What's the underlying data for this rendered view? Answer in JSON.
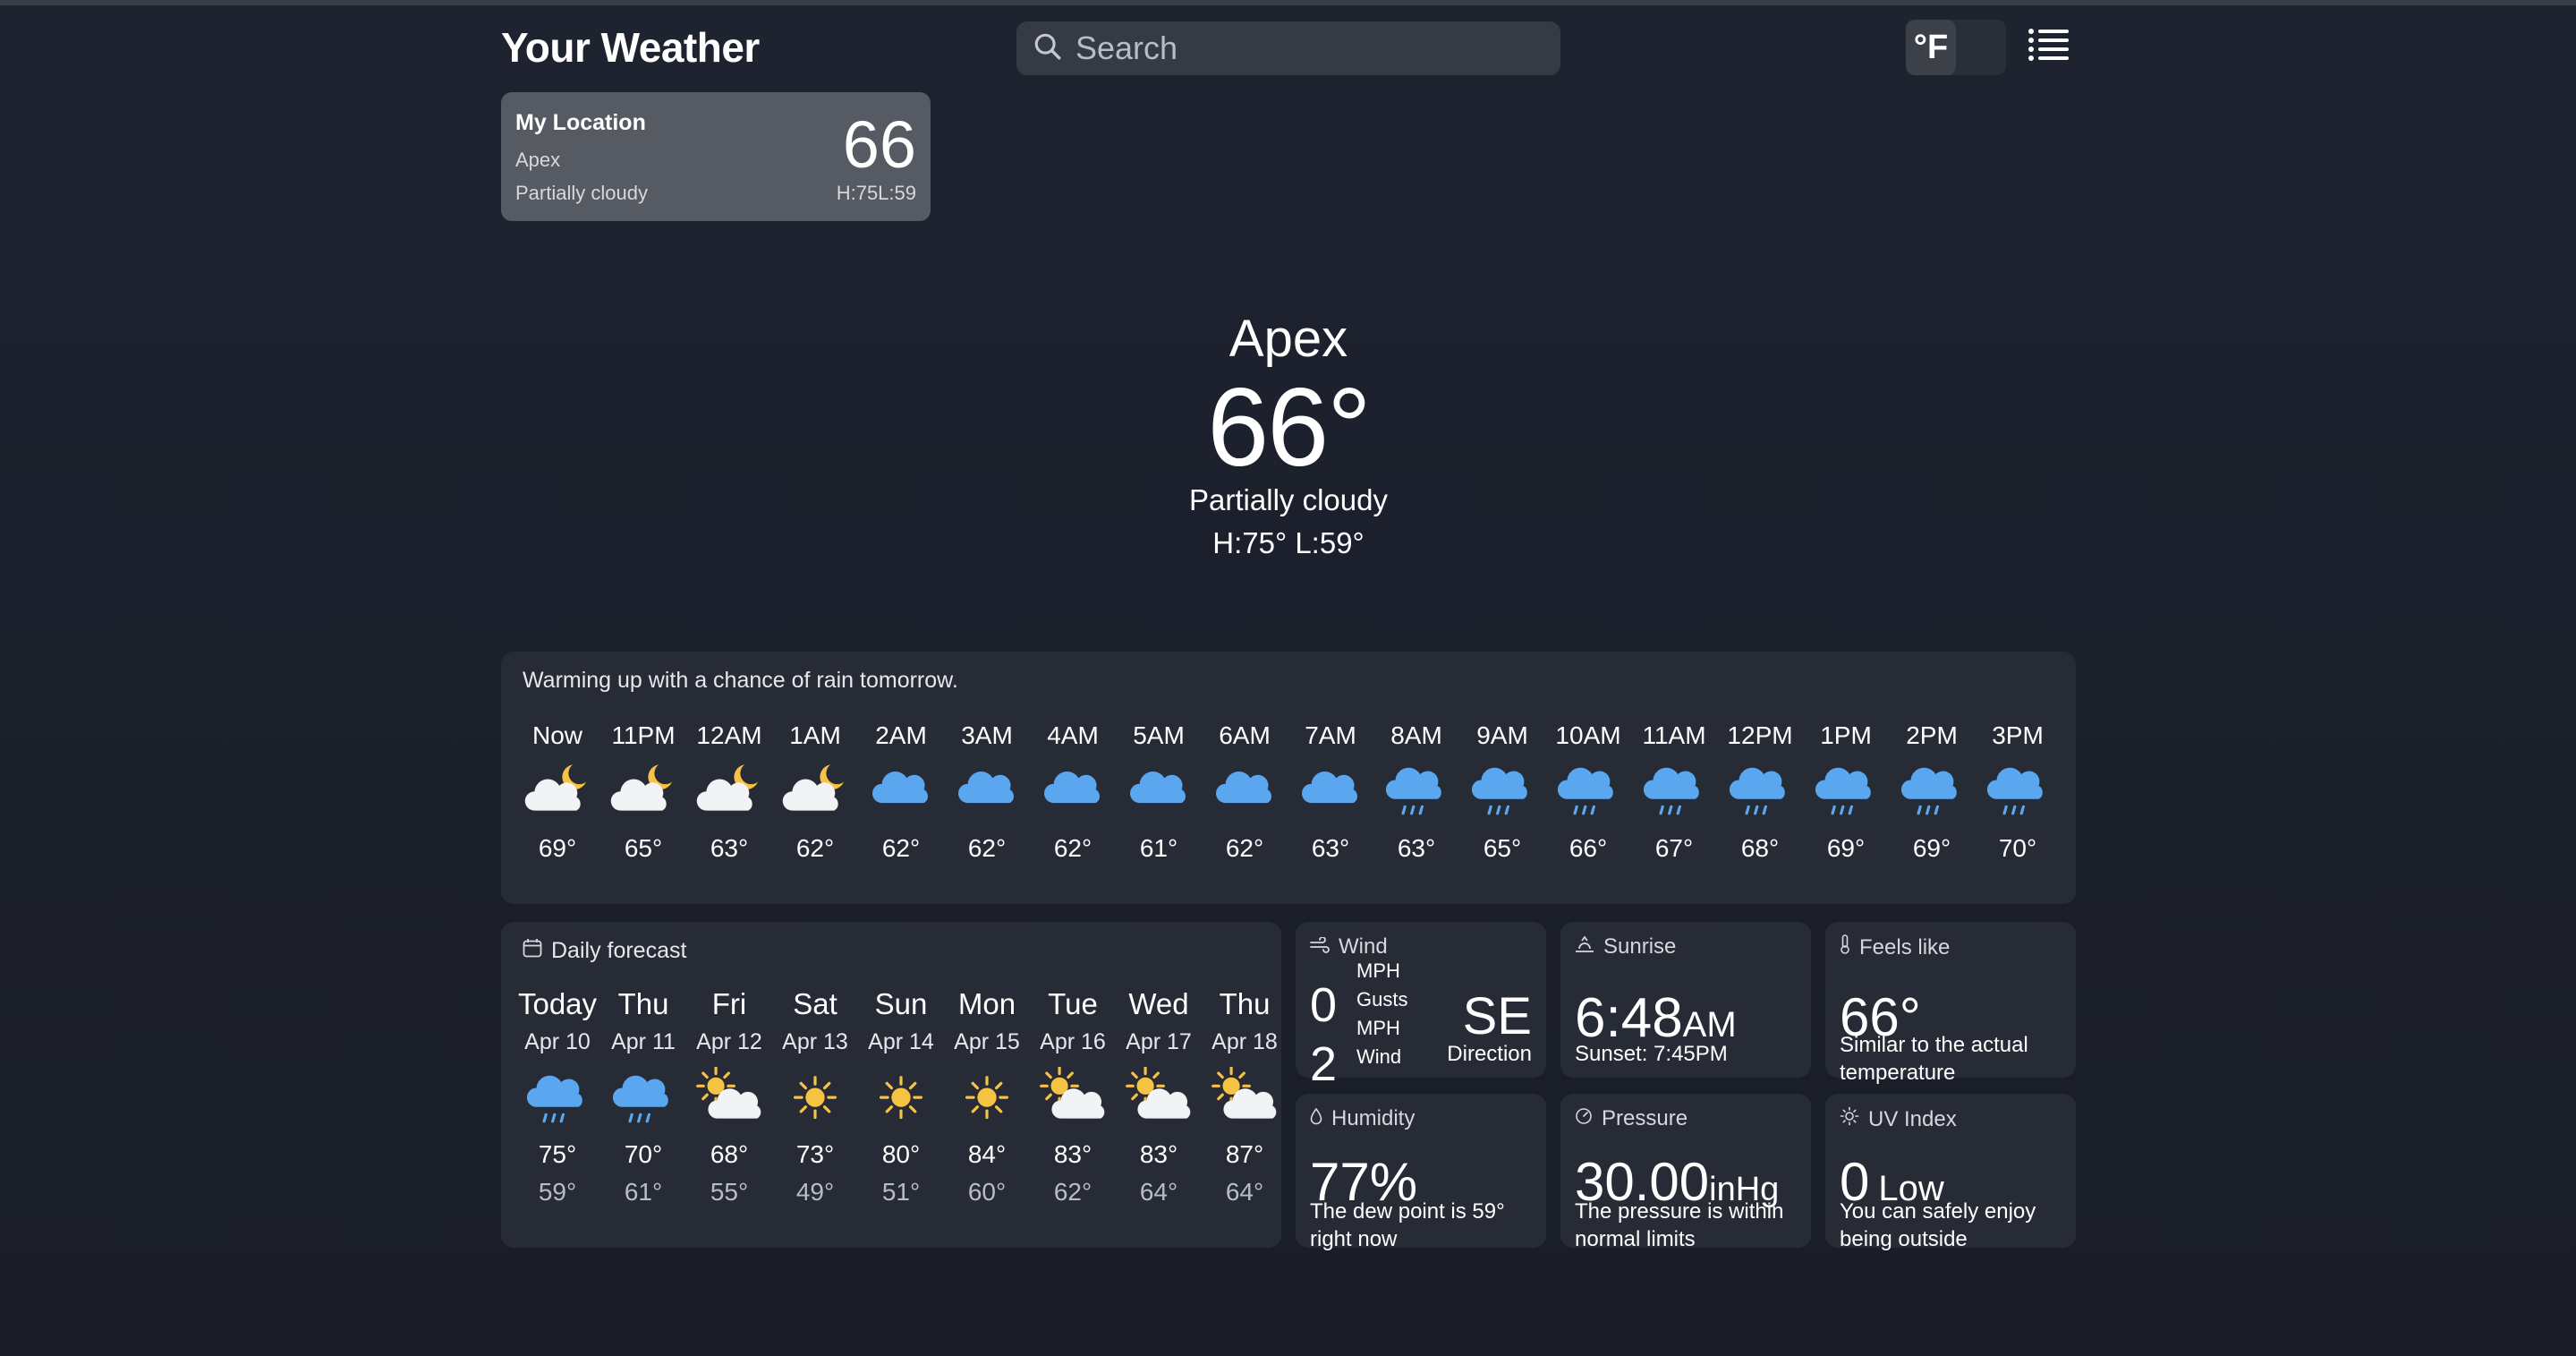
{
  "app": {
    "title": "Your Weather"
  },
  "search": {
    "placeholder": "Search"
  },
  "units": {
    "active": "°F",
    "inactive": ""
  },
  "location_card": {
    "name": "My Location",
    "place": "Apex",
    "condition": "Partially cloudy",
    "temp": "66",
    "high_low": "H:75L:59"
  },
  "current": {
    "city": "Apex",
    "temp": "66°",
    "condition": "Partially cloudy",
    "high_low": "H:75°  L:59°"
  },
  "hourly": {
    "summary": "Warming up with a chance of rain tomorrow.",
    "items": [
      {
        "time": "Now",
        "icon": "cloud-moon-icon",
        "temp": "69°"
      },
      {
        "time": "11PM",
        "icon": "cloud-moon-icon",
        "temp": "65°"
      },
      {
        "time": "12AM",
        "icon": "cloud-moon-icon",
        "temp": "63°"
      },
      {
        "time": "1AM",
        "icon": "cloud-moon-icon",
        "temp": "62°"
      },
      {
        "time": "2AM",
        "icon": "cloud-icon",
        "temp": "62°"
      },
      {
        "time": "3AM",
        "icon": "cloud-icon",
        "temp": "62°"
      },
      {
        "time": "4AM",
        "icon": "cloud-icon",
        "temp": "62°"
      },
      {
        "time": "5AM",
        "icon": "cloud-icon",
        "temp": "61°"
      },
      {
        "time": "6AM",
        "icon": "cloud-icon",
        "temp": "62°"
      },
      {
        "time": "7AM",
        "icon": "cloud-icon",
        "temp": "63°"
      },
      {
        "time": "8AM",
        "icon": "cloud-rain-icon",
        "temp": "63°"
      },
      {
        "time": "9AM",
        "icon": "cloud-rain-icon",
        "temp": "65°"
      },
      {
        "time": "10AM",
        "icon": "cloud-rain-icon",
        "temp": "66°"
      },
      {
        "time": "11AM",
        "icon": "cloud-rain-icon",
        "temp": "67°"
      },
      {
        "time": "12PM",
        "icon": "cloud-rain-icon",
        "temp": "68°"
      },
      {
        "time": "1PM",
        "icon": "cloud-rain-icon",
        "temp": "69°"
      },
      {
        "time": "2PM",
        "icon": "cloud-rain-icon",
        "temp": "69°"
      },
      {
        "time": "3PM",
        "icon": "cloud-rain-icon",
        "temp": "70°"
      }
    ]
  },
  "daily": {
    "title": "Daily forecast",
    "items": [
      {
        "day": "Today",
        "date": "Apr 10",
        "icon": "cloud-rain-icon",
        "high": "75°",
        "low": "59°"
      },
      {
        "day": "Thu",
        "date": "Apr 11",
        "icon": "cloud-rain-icon",
        "high": "70°",
        "low": "61°"
      },
      {
        "day": "Fri",
        "date": "Apr 12",
        "icon": "cloud-sun-icon",
        "high": "68°",
        "low": "55°"
      },
      {
        "day": "Sat",
        "date": "Apr 13",
        "icon": "sun-icon",
        "high": "73°",
        "low": "49°"
      },
      {
        "day": "Sun",
        "date": "Apr 14",
        "icon": "sun-icon",
        "high": "80°",
        "low": "51°"
      },
      {
        "day": "Mon",
        "date": "Apr 15",
        "icon": "sun-icon",
        "high": "84°",
        "low": "60°"
      },
      {
        "day": "Tue",
        "date": "Apr 16",
        "icon": "cloud-sun-icon",
        "high": "83°",
        "low": "62°"
      },
      {
        "day": "Wed",
        "date": "Apr 17",
        "icon": "cloud-sun-icon",
        "high": "83°",
        "low": "64°"
      },
      {
        "day": "Thu",
        "date": "Apr 18",
        "icon": "cloud-sun-icon",
        "high": "87°",
        "low": "64°"
      }
    ]
  },
  "wind": {
    "title": "Wind",
    "speed": "0",
    "speed_unit": "MPH",
    "speed_label": "Gusts",
    "gust": "2",
    "gust_unit": "MPH",
    "gust_label": "Wind",
    "direction": "SE",
    "direction_label": "Direction"
  },
  "sunrise": {
    "title": "Sunrise",
    "time": "6:48",
    "ampm": "AM",
    "sunset": "Sunset: 7:45PM"
  },
  "feels_like": {
    "title": "Feels like",
    "value": "66°",
    "desc": "Similar to the actual temperature"
  },
  "humidity": {
    "title": "Humidity",
    "value": "77%",
    "desc": "The dew point is 59° right now"
  },
  "pressure": {
    "title": "Pressure",
    "value": "30.00",
    "unit": "inHg",
    "desc": "The pressure is within normal limits"
  },
  "uv": {
    "title": "UV Index",
    "value": "0",
    "level": "Low",
    "desc": "You can safely enjoy being outside"
  },
  "colors": {
    "background": "#1c202b",
    "panel": "#272b35",
    "cloud_blue": "#5aa7f0",
    "cloud_white": "#f2f3f5",
    "sun_yellow": "#f6c244"
  }
}
